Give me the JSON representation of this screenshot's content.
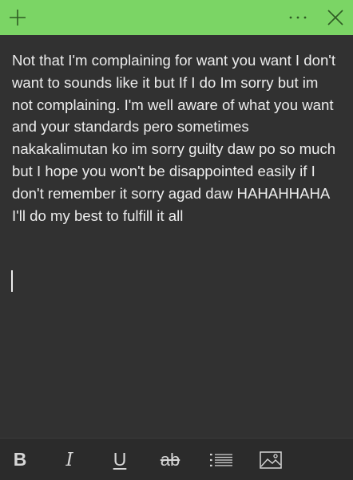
{
  "app": {
    "accent_color": "#7bd565",
    "background_color": "#313131"
  },
  "titlebar": {
    "new_note_icon": "plus-icon",
    "more_icon": "ellipsis-icon",
    "close_icon": "close-icon"
  },
  "note": {
    "text": "Not that I'm complaining for want you want I don't want to sounds like it but If I do Im sorry but im not complaining. I'm well aware of what you want and your standards pero sometimes nakakalimutan ko im sorry guilty daw po so much but I hope you won't be disappointed easily if I don't remember it sorry agad daw HAHAHHAHA I'll do my best to fulfill it all"
  },
  "toolbar": {
    "bold_label": "B",
    "italic_label": "I",
    "underline_label": "U",
    "strikethrough_label": "ab",
    "bullets_icon": "bulleted-list-icon",
    "image_icon": "image-icon"
  }
}
